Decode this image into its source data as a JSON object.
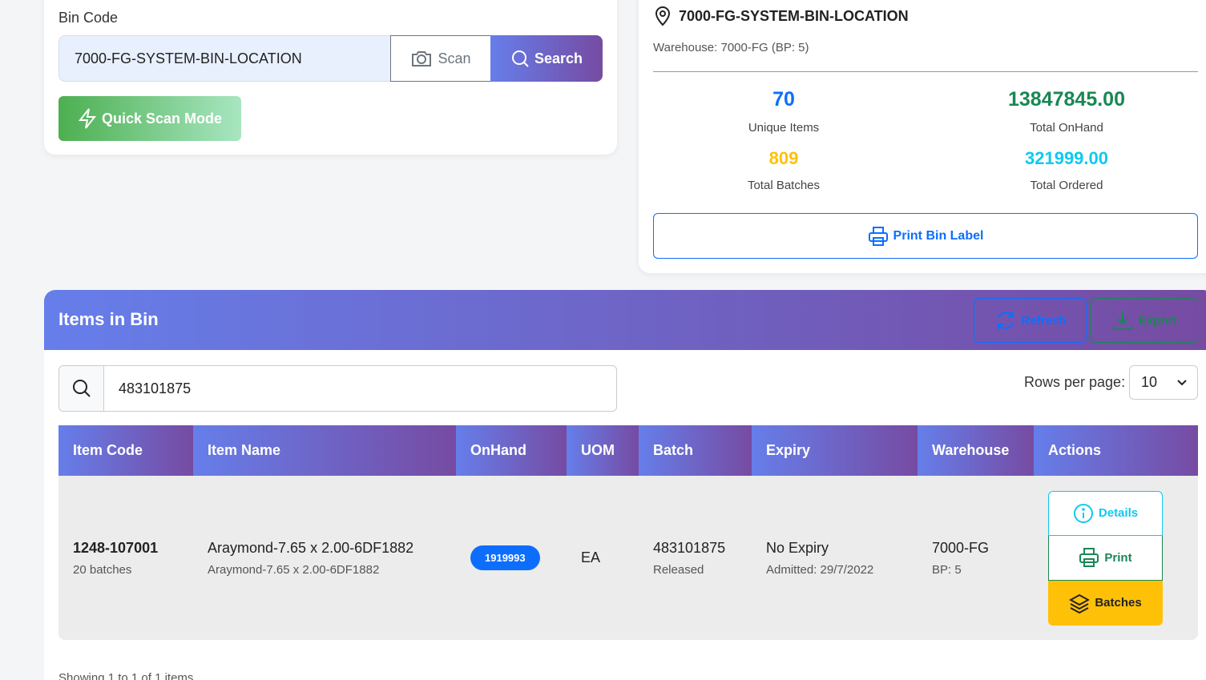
{
  "search": {
    "label": "Bin Code",
    "value": "7000-FG-SYSTEM-BIN-LOCATION",
    "scan_label": "Scan",
    "search_label": "Search",
    "quick_scan_label": "Quick Scan Mode"
  },
  "summary": {
    "location": "7000-FG-SYSTEM-BIN-LOCATION",
    "warehouse": "Warehouse: 7000-FG (BP: 5)",
    "unique_items": "70",
    "unique_items_label": "Unique Items",
    "total_onhand": "13847845.00",
    "total_onhand_label": "Total OnHand",
    "total_batches": "809",
    "total_batches_label": "Total Batches",
    "total_ordered": "321999.00",
    "total_ordered_label": "Total Ordered",
    "print_label": "Print Bin Label",
    "colors": {
      "unique": "#0d6efd",
      "onhand": "#198754",
      "batches": "#ffc107",
      "ordered": "#0dcaf0"
    }
  },
  "items": {
    "title": "Items in Bin",
    "refresh_label": "Refresh",
    "export_label": "Export",
    "filter_value": "483101875",
    "rows_per_page_label": "Rows per page:",
    "rows_per_page_value": "10",
    "columns": [
      "Item Code",
      "Item Name",
      "OnHand",
      "UOM",
      "Batch",
      "Expiry",
      "Warehouse",
      "Actions"
    ],
    "rows": [
      {
        "item_code": "1248-107001",
        "batches_count": "20 batches",
        "item_name": "Araymond-7.65 x 2.00-6DF1882",
        "item_desc": "Araymond-7.65 x 2.00-6DF1882",
        "onhand": "1919993",
        "uom": "EA",
        "batch": "483101875",
        "batch_status": "Released",
        "expiry": "No Expiry",
        "admitted": "Admitted: 29/7/2022",
        "warehouse": "7000-FG",
        "bp": "BP: 5",
        "details_label": "Details",
        "print_label": "Print",
        "batches_label": "Batches"
      }
    ],
    "showing": "Showing 1 to 1 of 1 items"
  }
}
